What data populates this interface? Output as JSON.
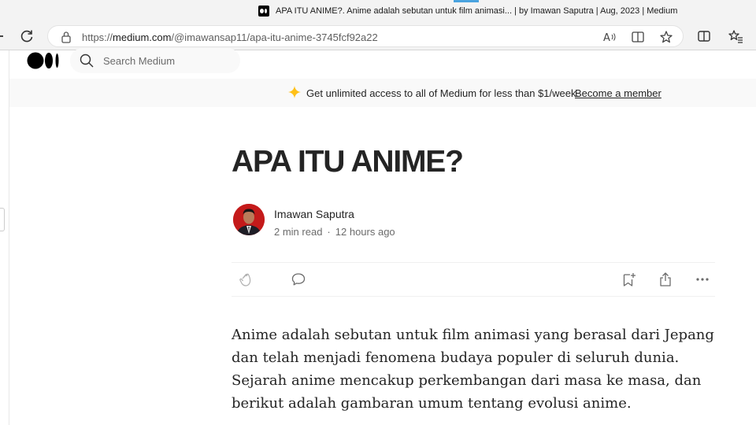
{
  "browser": {
    "tab_title": "APA ITU ANIME?. Anime adalah sebutan untuk film animasi... | by Imawan Saputra | Aug, 2023 | Medium",
    "url_prefix": "https://",
    "url_host": "medium.com",
    "url_path": "/@imawansap11/apa-itu-anime-3745fcf92a22",
    "accent_color": "#4aa3df"
  },
  "header": {
    "logo_icon": "medium-logo-icon",
    "search_placeholder": "Search Medium"
  },
  "banner": {
    "text": "Get unlimited access to all of Medium for less than $1/week.",
    "link": "Become a member",
    "star_color": "#ffc017"
  },
  "article": {
    "title": "APA ITU ANIME?",
    "author": "Imawan Saputra",
    "read_time": "2 min read",
    "separator": "·",
    "published": "12 hours ago",
    "body": "Anime adalah sebutan untuk film animasi yang berasal dari Jepang dan telah menjadi fenomena budaya populer di seluruh dunia. Sejarah anime mencakup perkembangan dari masa ke masa, dan berikut adalah gambaran umum tentang evolusi anime."
  },
  "actions": {
    "left": [
      "clap-icon",
      "comment-icon"
    ],
    "right": [
      "bookmark-add-icon",
      "share-icon",
      "more-icon"
    ]
  }
}
